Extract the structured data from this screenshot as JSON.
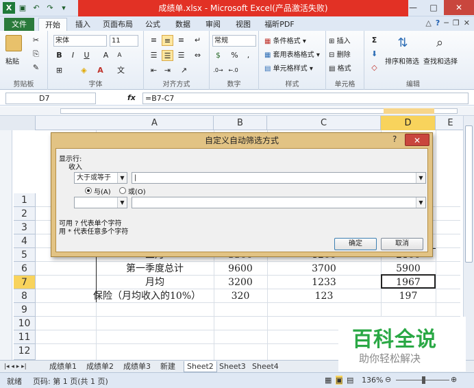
{
  "window": {
    "title": "成绩单.xlsx - Microsoft Excel(产品激活失败)",
    "controls": [
      "—",
      "□",
      "✕"
    ]
  },
  "tabs": [
    "文件",
    "开始",
    "插入",
    "页面布局",
    "公式",
    "数据",
    "审阅",
    "视图",
    "福昕PDF"
  ],
  "ribbon": {
    "clipboard": {
      "paste": "粘贴",
      "label": "剪贴板"
    },
    "font": {
      "name": "宋体",
      "size": "11",
      "label": "字体",
      "bold": "B",
      "italic": "I",
      "underline": "U",
      "grow": "A",
      "shrink": "A"
    },
    "align": {
      "label": "对齐方式"
    },
    "number": {
      "format": "常规",
      "percent": "%",
      "comma": ",",
      "label": "数字"
    },
    "styles": {
      "cond": "条件格式",
      "table": "套用表格格式",
      "cell": "单元格样式",
      "label": "样式"
    },
    "cells": {
      "insert": "插入",
      "delete": "删除",
      "format": "格式",
      "label": "单元格"
    },
    "edit": {
      "sort": "排序和筛选",
      "find": "查找和选择",
      "label": "编辑"
    }
  },
  "formula_bar": {
    "name_box": "D7",
    "fx": "fx",
    "formula": "=B7-C7"
  },
  "columns": [
    "A",
    "B",
    "C",
    "D",
    "E"
  ],
  "rows": [
    "1",
    "2",
    "3",
    "4",
    "5",
    "6",
    "7",
    "8",
    "9",
    "10",
    "11",
    "12"
  ],
  "cells": {
    "r5": {
      "a": "三月",
      "b": "3300",
      "c": "1200",
      "d": "2100"
    },
    "r6": {
      "a": "第一季度总计",
      "b": "9600",
      "c": "3700",
      "d": "5900"
    },
    "r7": {
      "a": "月均",
      "b": "3200",
      "c": "1233",
      "d": "1967"
    },
    "r8": {
      "a": "保险（月均收入的10%）",
      "b": "320",
      "c": "123",
      "d": "197"
    }
  },
  "dialog": {
    "title": "自定义自动筛选方式",
    "help": "?",
    "close": "✕",
    "show_rows": "显示行:",
    "field": "收入",
    "op1": "大于或等于",
    "val1": "|",
    "and": "与(A)",
    "or": "或(O)",
    "op2": "",
    "val2": "",
    "hint1": "可用 ? 代表单个字符",
    "hint2": "用 * 代表任意多个字符",
    "ok": "确定",
    "cancel": "取消"
  },
  "sheet_tabs": [
    "成绩单1",
    "成绩单2",
    "成绩单3",
    "新建",
    "Sheet2",
    "Sheet3",
    "Sheet4"
  ],
  "status": {
    "ready": "就绪",
    "page": "页码: 第 1 页(共 1 页)",
    "zoom": "136%"
  },
  "watermark": {
    "line1": "百科全说",
    "line2": "助你轻松解决"
  }
}
